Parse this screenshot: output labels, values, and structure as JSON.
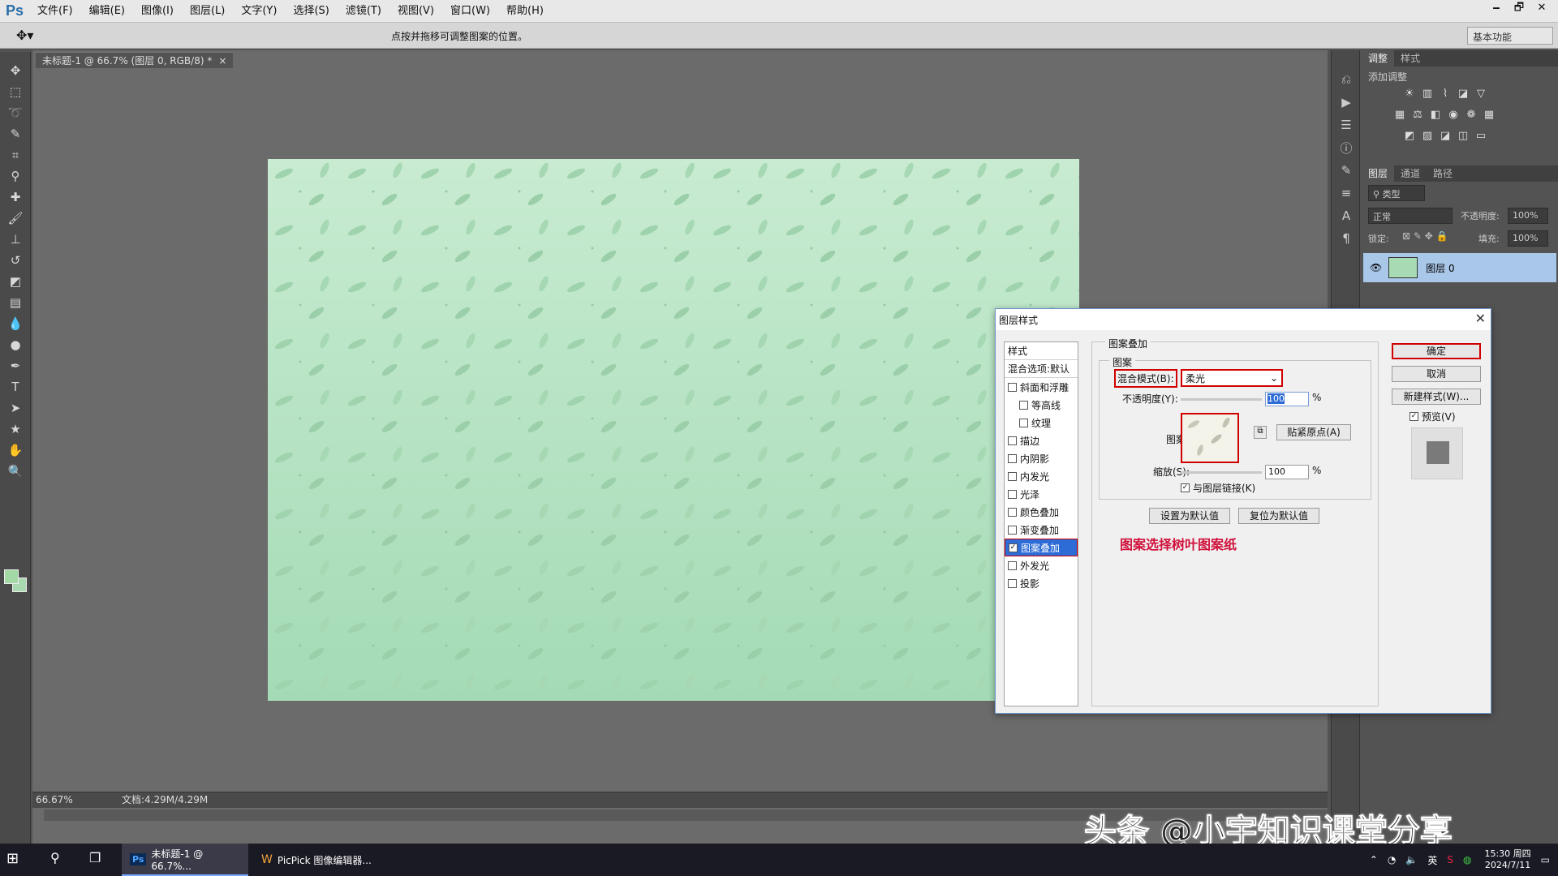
{
  "app": {
    "logo": "Ps",
    "menu": [
      "文件(F)",
      "编辑(E)",
      "图像(I)",
      "图层(L)",
      "文字(Y)",
      "选择(S)",
      "滤镜(T)",
      "视图(V)",
      "窗口(W)",
      "帮助(H)"
    ]
  },
  "window_controls": {
    "minimize": "🗕",
    "restore": "🗗",
    "close": "✕"
  },
  "options": {
    "hint": "点按并拖移可调整图案的位置。",
    "workspace": "基本功能"
  },
  "document": {
    "tab_label": "未标题-1 @ 66.7% (图层 0, RGB/8) *",
    "tab_close": "×",
    "zoom": "66.67%",
    "doc_size": "文档:4.29M/4.29M",
    "canvas_color": "#b6e3c4"
  },
  "tools": [
    "move-icon",
    "marquee-icon",
    "lasso-icon",
    "quick-select-icon",
    "crop-icon",
    "eyedropper-icon",
    "healing-icon",
    "brush-icon",
    "stamp-icon",
    "history-brush-icon",
    "eraser-icon",
    "gradient-icon",
    "blur-icon",
    "dodge-icon",
    "pen-icon",
    "type-icon",
    "path-select-icon",
    "shape-icon",
    "hand-icon",
    "zoom-icon"
  ],
  "right_panels": {
    "adjust_tabs": [
      "调整",
      "样式"
    ],
    "adjust_label": "添加调整",
    "layer_tabs": [
      "图层",
      "通道",
      "路径"
    ],
    "layer_filter": "类型",
    "blend_mode": "正常",
    "opacity_label": "不透明度:",
    "opacity_value": "100%",
    "lock_label": "锁定:",
    "fill_label": "填充:",
    "fill_value": "100%",
    "layer_name": "图层 0"
  },
  "dialog": {
    "title": "图层样式",
    "close": "✕",
    "styles_header": "样式",
    "blend_options": "混合选项:默认",
    "items": [
      {
        "label": "斜面和浮雕",
        "checked": false,
        "indent": false
      },
      {
        "label": "等高线",
        "checked": false,
        "indent": true
      },
      {
        "label": "纹理",
        "checked": false,
        "indent": true
      },
      {
        "label": "描边",
        "checked": false,
        "indent": false
      },
      {
        "label": "内阴影",
        "checked": false,
        "indent": false
      },
      {
        "label": "内发光",
        "checked": false,
        "indent": false
      },
      {
        "label": "光泽",
        "checked": false,
        "indent": false
      },
      {
        "label": "颜色叠加",
        "checked": false,
        "indent": false
      },
      {
        "label": "渐变叠加",
        "checked": false,
        "indent": false
      },
      {
        "label": "图案叠加",
        "checked": true,
        "indent": false
      },
      {
        "label": "外发光",
        "checked": false,
        "indent": false
      },
      {
        "label": "投影",
        "checked": false,
        "indent": false
      }
    ],
    "group_title": "图案叠加",
    "sub_title": "图案",
    "blend_label": "混合模式(B):",
    "blend_value": "柔光",
    "opacity_label": "不透明度(Y):",
    "opacity_value": "100",
    "percent": "%",
    "pattern_label": "图案:",
    "snap_button": "贴紧原点(A)",
    "scale_label": "缩放(S):",
    "scale_value": "100",
    "link_label": "与图层链接(K)",
    "set_default": "设置为默认值",
    "reset_default": "复位为默认值",
    "note": "图案选择树叶图案纸",
    "ok": "确定",
    "cancel": "取消",
    "new_style": "新建样式(W)...",
    "preview": "预览(V)"
  },
  "watermark": "头条 @小宇知识课堂分享",
  "taskbar": {
    "ps_task": "未标题-1 @ 66.7%...",
    "picpick_task": "PicPick 图像编辑器...",
    "ime": "英",
    "time": "15:30 周四",
    "date": "2024/7/11"
  }
}
